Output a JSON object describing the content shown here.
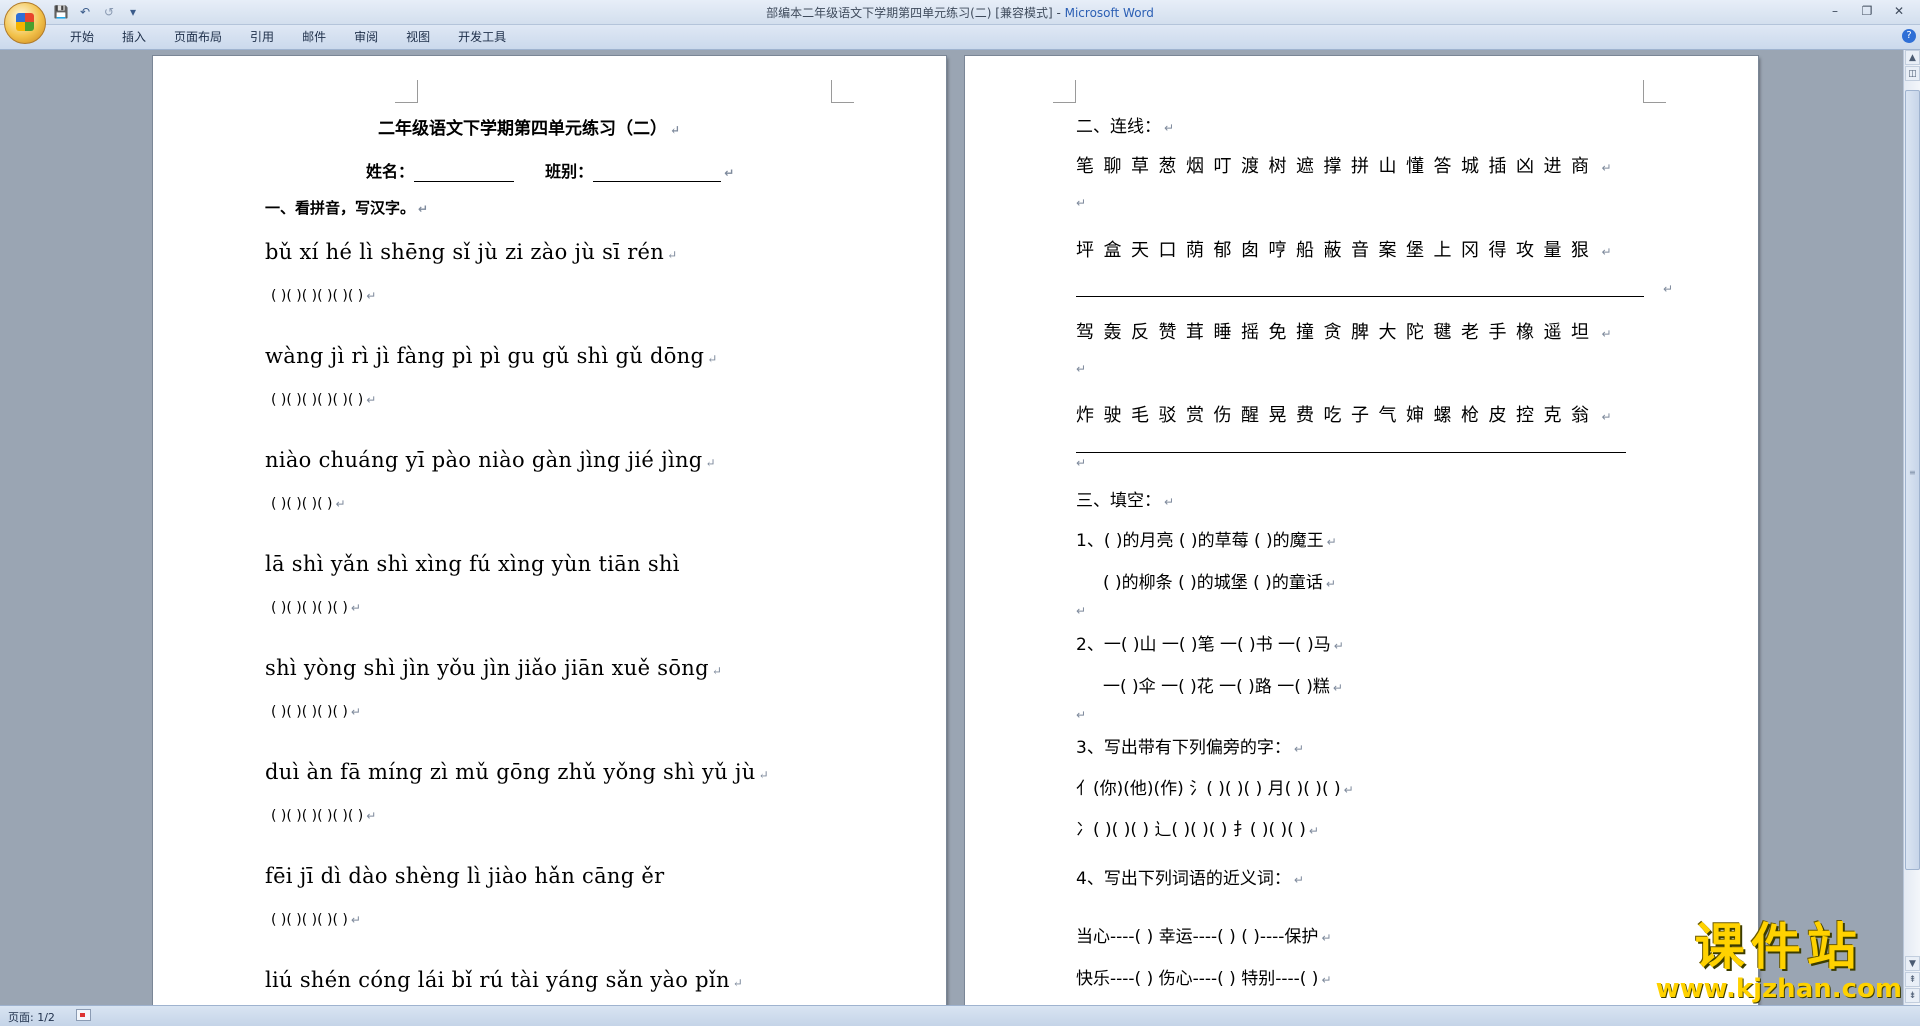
{
  "window": {
    "title": "部编本二年级语文下学期第四单元练习(二) [兼容模式]",
    "separator": " - ",
    "app_name": "Microsoft Word"
  },
  "quick_access": {
    "save_icon": "💾",
    "undo_icon": "↶",
    "redo_icon": "↺",
    "customize_icon": "▾"
  },
  "window_controls": {
    "minimize": "–",
    "restore": "❐",
    "close": "✕"
  },
  "ribbon": {
    "tabs": [
      "开始",
      "插入",
      "页面布局",
      "引用",
      "邮件",
      "审阅",
      "视图",
      "开发工具"
    ],
    "help": "?"
  },
  "paragraph_mark": "↵",
  "page1": {
    "title": "二年级语文下学期第四单元练习（二）",
    "name_label": "姓名：",
    "class_label": "班别：",
    "section1_heading": "一、看拼音，写汉字。",
    "rows": [
      {
        "pinyin": " bǔ xí   hé lì   shēng sǐ   jù zi   zào jù   sī rén",
        "parens": "(       )(       )(              )(       )(          )(          )"
      },
      {
        "pinyin": " wàng jì   rì jì   fàng pì   pì gu   gǔ shì   gǔ dōng",
        "parens": "(           )(       )(           )(        )(        )(           )"
      },
      {
        "pinyin": " niào chuáng   yī pào niào   gàn jìng   jié jìng",
        "parens": "(                 )(                 )(            )(            )"
      },
      {
        "pinyin": " lā shì   yǎn shì   xìng fú   xìng yùn   tiān shì",
        "parens": "(         )(           )(           )(            )(           )"
      },
      {
        "pinyin": "shì yòng   shì jìn   yǒu jìn   jiǎo jiān   xuě sōng",
        "parens": "(           )(           )(           )(              )(           )"
      },
      {
        "pinyin": "duì àn   fā míng   zì mǔ   gōng zhǔ   yǒng shì   yǔ jù",
        "parens": "(        )(           )(         )(            )(            )(        )"
      },
      {
        "pinyin": " fēi jī   dì dào   shèng lì   jiào hǎn   cāng ěr",
        "parens": "(          )(           )(            )(             )(           )"
      },
      {
        "pinyin": "liú shén   cóng lái   bǐ rú   tài yáng sǎn   yào pǐn",
        "parens": ""
      }
    ]
  },
  "page2": {
    "section2_heading": "二、连线：",
    "line_rows": [
      "笔聊草葱烟叮渡树遮撑拼山懂答城插凶进商",
      "坪盒天口荫郁囱哼船蔽音案堡上冈得攻量狠",
      "驾轰反赞茸睡摇免撞贪脾大陀毽老手橡遥坦",
      "炸驶毛驳赏伤醒晃费吃子气婶螺枪皮控克翁"
    ],
    "section3_heading": "三、填空：",
    "q1": {
      "label": "1、",
      "line1": "(          )的月亮    (          )的草莓    (          )的魔王",
      "line2": "(          )的柳条    (          )的城堡    (          )的童话"
    },
    "q2": {
      "label": "2、",
      "line1": "一(    )山     一(    )笔     一(    )书     一(    )马",
      "line2": "一(    )伞     一(    )花     一(    )路     一(    )糕"
    },
    "q3": {
      "heading": "3、写出带有下列偏旁的字：",
      "line1": "亻(你)(他)(作)    氵(   )(   )(   )    月(   )(   )(   )",
      "line2": "冫(   )(   )(   )    辶(   )(   )(   )    扌(   )(   )(   )"
    },
    "q4": {
      "heading": "4、写出下列词语的近义词：",
      "line1": "当心----(      )    幸运----(      )    (         )----保护",
      "line2": "快乐----(      )    伤心----(      )    特别----(      )"
    }
  },
  "status_bar": {
    "page_info": "页面: 1/2"
  },
  "watermark": {
    "brand": "课件站",
    "url": "www.kjzhan.com"
  }
}
